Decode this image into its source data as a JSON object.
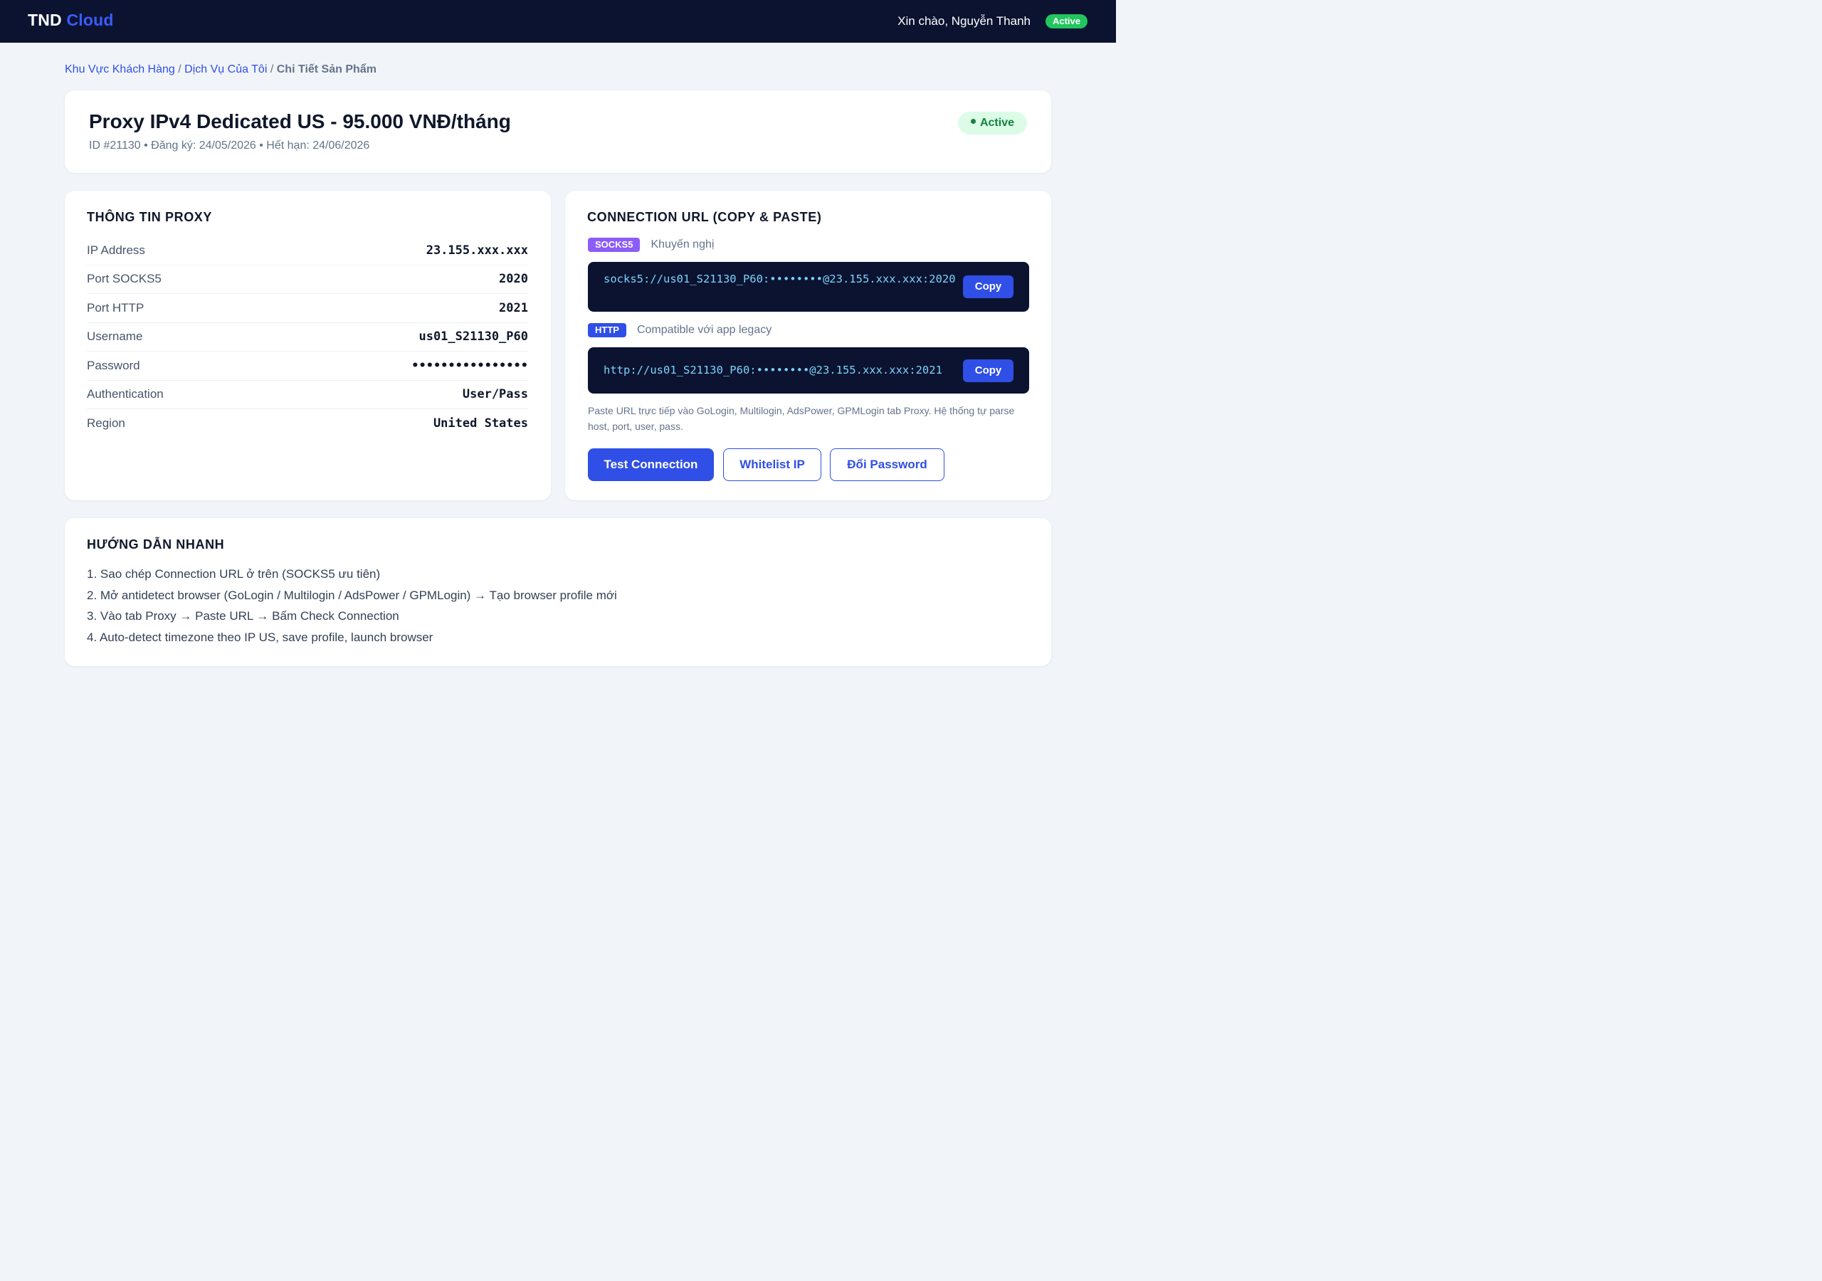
{
  "header": {
    "brand_main": "TND",
    "brand_accent": "Cloud",
    "greeting": "Xin chào, Nguyễn Thanh",
    "status_badge": "Active"
  },
  "breadcrumb": {
    "items": [
      "Khu Vực Khách Hàng",
      "Dịch Vụ Của Tôi"
    ],
    "separator": "/",
    "current": "Chi Tiết Sản Phẩm"
  },
  "product": {
    "title": "Proxy IPv4 Dedicated US - 95.000 VNĐ/tháng",
    "meta": "ID #21130 • Đăng ký: 24/05/2026 • Hết hạn: 24/06/2026",
    "status": "Active"
  },
  "proxy_info": {
    "title": "THÔNG TIN PROXY",
    "rows": [
      {
        "label": "IP Address",
        "value": "23.155.xxx.xxx"
      },
      {
        "label": "Port SOCKS5",
        "value": "2020"
      },
      {
        "label": "Port HTTP",
        "value": "2021"
      },
      {
        "label": "Username",
        "value": "us01_S21130_P60"
      },
      {
        "label": "Password",
        "value": "••••••••••••••••"
      },
      {
        "label": "Authentication",
        "value": "User/Pass"
      },
      {
        "label": "Region",
        "value": "United States"
      }
    ]
  },
  "connection": {
    "title": "CONNECTION URL (COPY & PASTE)",
    "socks5": {
      "tag": "SOCKS5",
      "note": "Khuyến nghị",
      "url": "socks5://us01_S21130_P60:••••••••@23.155.xxx.xxx:2020",
      "copy_label": "Copy"
    },
    "http": {
      "tag": "HTTP",
      "note": "Compatible với app legacy",
      "url": "http://us01_S21130_P60:••••••••@23.155.xxx.xxx:2021",
      "copy_label": "Copy"
    },
    "hint": "Paste URL trực tiếp vào GoLogin, Multilogin, AdsPower, GPMLogin tab Proxy. Hệ thống tự parse host, port, user, pass.",
    "buttons": {
      "test": "Test Connection",
      "whitelist": "Whitelist IP",
      "password": "Đổi Password"
    }
  },
  "guide": {
    "title": "HƯỚNG DẪN NHANH",
    "steps": [
      "1. Sao chép Connection URL ở trên (SOCKS5 ưu tiên)",
      "2. Mở antidetect browser (GoLogin / Multilogin / AdsPower / GPMLogin) → Tạo browser profile mới",
      "3. Vào tab Proxy → Paste URL → Bấm Check Connection",
      "4. Auto-detect timezone theo IP US, save profile, launch browser"
    ]
  },
  "colors": {
    "topbar": "#0b1330",
    "accent": "#2f4fe6",
    "success": "#22c55e",
    "socks_tag": "#8b5cf6",
    "url_text": "#7dd3fc"
  }
}
